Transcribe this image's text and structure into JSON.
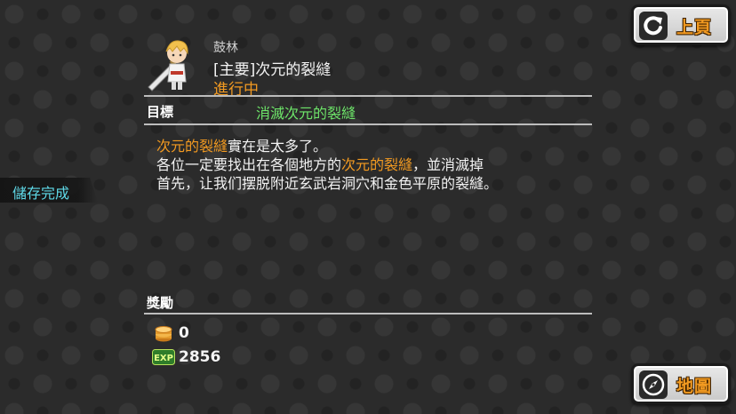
{
  "buttons": {
    "back_label": "上頁",
    "map_label": "地圖"
  },
  "save_status": "儲存完成",
  "quest": {
    "npc_name": "鼓林",
    "title": "[主要]次元的裂縫",
    "status": "進行中"
  },
  "goal": {
    "label": "目標",
    "text": "消滅次元的裂縫"
  },
  "description": {
    "line1_hl": "次元的裂縫",
    "line1_rest": "實在是太多了。",
    "line2_pre": "各位一定要找出在各個地方的",
    "line2_hl": "次元的裂縫",
    "line2_post": "，並消滅掉",
    "line3": "首先，让我们摆脱附近玄武岩洞穴和金色平原的裂縫。"
  },
  "reward": {
    "label": "獎勵",
    "coins": "0",
    "exp": "2856"
  },
  "colors": {
    "accent_orange": "#f29a21",
    "goal_green": "#6ee66a",
    "save_cyan": "#5fd9e8"
  },
  "icons": {
    "back": "refresh-arrow-icon",
    "map": "compass-icon",
    "coin": "coin-stack-icon",
    "exp": "exp-icon"
  }
}
